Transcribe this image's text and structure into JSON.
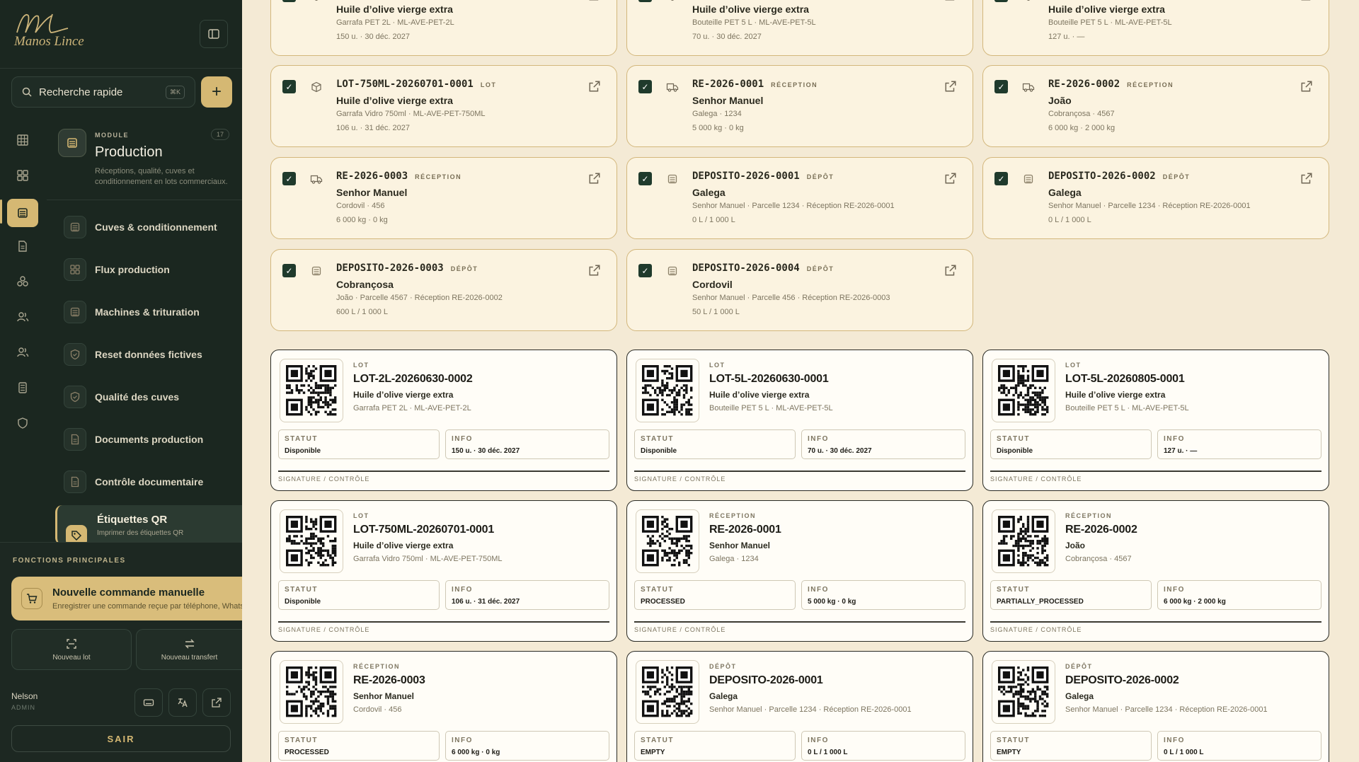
{
  "brand": {
    "initials": "ML",
    "name": "Manos Lince"
  },
  "search": {
    "label": "Recherche rapide",
    "shortcut": "⌘K"
  },
  "module": {
    "tag": "MODULE",
    "count": "17",
    "title": "Production",
    "desc": "Réceptions, qualité, cuves et conditionnement en lots commerciaux."
  },
  "nav": [
    {
      "label": "Cuves & conditionnement",
      "icon": "tank-icon"
    },
    {
      "label": "Flux production",
      "icon": "grid-icon"
    },
    {
      "label": "Machines & trituration",
      "icon": "machine-icon"
    },
    {
      "label": "Reset données fictives",
      "icon": "shield-icon"
    },
    {
      "label": "Qualité des cuves",
      "icon": "shield-icon"
    },
    {
      "label": "Documents production",
      "icon": "document-icon"
    },
    {
      "label": "Contrôle documentaire",
      "icon": "document-icon"
    }
  ],
  "nav_active": {
    "label": "Étiquettes QR",
    "sub": "Imprimer des étiquettes QR"
  },
  "functions": {
    "title": "FONCTIONS PRINCIPALES",
    "cmd_title": "Nouvelle commande manuelle",
    "cmd_sub": "Enregistrer une commande reçue par téléphone, WhatsApp",
    "new_lot": "Nouveau lot",
    "new_transfer": "Nouveau transfert"
  },
  "user": {
    "name": "Nelson",
    "role": "ADMIN",
    "logout": "SAIR"
  },
  "list_cards": [
    {
      "code": "",
      "tag": "",
      "name": "Huile d’olive vierge extra",
      "meta": "Garrafa PET 2L · ML-AVE-PET-2L",
      "qty": "150 u. · 30 déc. 2027",
      "icon": "box-icon"
    },
    {
      "code": "",
      "tag": "",
      "name": "Huile d’olive vierge extra",
      "meta": "Bouteille PET 5 L · ML-AVE-PET-5L",
      "qty": "70 u. · 30 déc. 2027",
      "icon": "box-icon"
    },
    {
      "code": "",
      "tag": "",
      "name": "Huile d’olive vierge extra",
      "meta": "Bouteille PET 5 L · ML-AVE-PET-5L",
      "qty": "127 u. · —",
      "icon": "box-icon"
    },
    {
      "code": "LOT-750ML-20260701-0001",
      "tag": "LOT",
      "name": "Huile d’olive vierge extra",
      "meta": "Garrafa Vidro 750ml · ML-AVE-PET-750ML",
      "qty": "106 u. · 31 déc. 2027",
      "icon": "box-icon"
    },
    {
      "code": "RE-2026-0001",
      "tag": "RÉCEPTION",
      "name": "Senhor Manuel",
      "meta": "Galega · 1234",
      "qty": "5 000 kg · 0 kg",
      "icon": "truck-icon"
    },
    {
      "code": "RE-2026-0002",
      "tag": "RÉCEPTION",
      "name": "João",
      "meta": "Cobrançosa · 4567",
      "qty": "6 000 kg · 2 000 kg",
      "icon": "truck-icon"
    },
    {
      "code": "RE-2026-0003",
      "tag": "RÉCEPTION",
      "name": "Senhor Manuel",
      "meta": "Cordovil · 456",
      "qty": "6 000 kg · 0 kg",
      "icon": "truck-icon"
    },
    {
      "code": "DEPOSITO-2026-0001",
      "tag": "DÉPÔT",
      "name": "Galega",
      "meta": "Senhor Manuel · Parcelle 1234 · Réception RE-2026-0001",
      "qty": "0 L / 1 000 L",
      "icon": "tank-icon"
    },
    {
      "code": "DEPOSITO-2026-0002",
      "tag": "DÉPÔT",
      "name": "Galega",
      "meta": "Senhor Manuel · Parcelle 1234 · Réception RE-2026-0001",
      "qty": "0 L / 1 000 L",
      "icon": "tank-icon"
    },
    {
      "code": "DEPOSITO-2026-0003",
      "tag": "DÉPÔT",
      "name": "Cobrançosa",
      "meta": "João · Parcelle 4567 · Réception RE-2026-0002",
      "qty": "600 L / 1 000 L",
      "icon": "tank-icon"
    },
    {
      "code": "DEPOSITO-2026-0004",
      "tag": "DÉPÔT",
      "name": "Cordovil",
      "meta": "Senhor Manuel · Parcelle 456 · Réception RE-2026-0003",
      "qty": "50 L / 1 000 L",
      "icon": "tank-icon"
    }
  ],
  "label_text": {
    "statut": "STATUT",
    "info": "INFO",
    "signature": "SIGNATURE / CONTRÔLE"
  },
  "labels": [
    {
      "tag": "LOT",
      "code": "LOT-2L-20260630-0002",
      "name": "Huile d’olive vierge extra",
      "meta": "Garrafa PET 2L · ML-AVE-PET-2L",
      "status": "Disponible",
      "info": "150 u. · 30 déc. 2027"
    },
    {
      "tag": "LOT",
      "code": "LOT-5L-20260630-0001",
      "name": "Huile d’olive vierge extra",
      "meta": "Bouteille PET 5 L · ML-AVE-PET-5L",
      "status": "Disponible",
      "info": "70 u. · 30 déc. 2027"
    },
    {
      "tag": "LOT",
      "code": "LOT-5L-20260805-0001",
      "name": "Huile d’olive vierge extra",
      "meta": "Bouteille PET 5 L · ML-AVE-PET-5L",
      "status": "Disponible",
      "info": "127 u. · —"
    },
    {
      "tag": "LOT",
      "code": "LOT-750ML-20260701-0001",
      "name": "Huile d’olive vierge extra",
      "meta": "Garrafa Vidro 750ml · ML-AVE-PET-750ML",
      "status": "Disponible",
      "info": "106 u. · 31 déc. 2027"
    },
    {
      "tag": "RÉCEPTION",
      "code": "RE-2026-0001",
      "name": "Senhor Manuel",
      "meta": "Galega · 1234",
      "status": "PROCESSED",
      "info": "5 000 kg · 0 kg"
    },
    {
      "tag": "RÉCEPTION",
      "code": "RE-2026-0002",
      "name": "João",
      "meta": "Cobrançosa · 4567",
      "status": "PARTIALLY_PROCESSED",
      "info": "6 000 kg · 2 000 kg"
    },
    {
      "tag": "RÉCEPTION",
      "code": "RE-2026-0003",
      "name": "Senhor Manuel",
      "meta": "Cordovil · 456",
      "status": "PROCESSED",
      "info": "6 000 kg · 0 kg"
    },
    {
      "tag": "DÉPÔT",
      "code": "DEPOSITO-2026-0001",
      "name": "Galega",
      "meta": "Senhor Manuel · Parcelle 1234 · Réception RE-2026-0001",
      "status": "EMPTY",
      "info": "0 L / 1 000 L"
    },
    {
      "tag": "DÉPÔT",
      "code": "DEPOSITO-2026-0002",
      "name": "Galega",
      "meta": "Senhor Manuel · Parcelle 1234 · Réception RE-2026-0001",
      "status": "EMPTY",
      "info": "0 L / 1 000 L"
    }
  ]
}
